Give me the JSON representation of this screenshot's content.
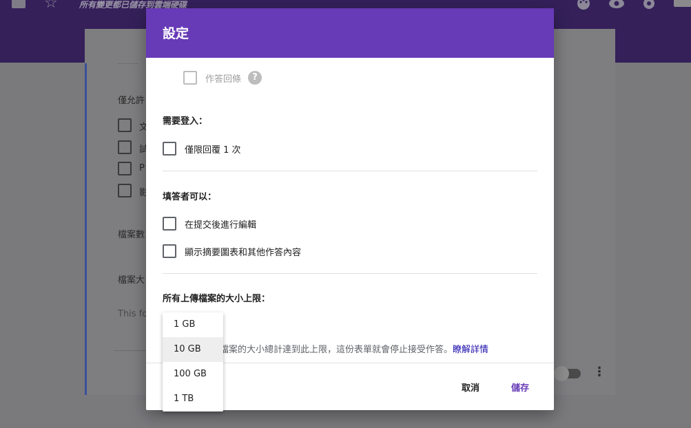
{
  "topbar": {
    "status_text": "所有變更都已儲存到雲端硬碟",
    "icons": [
      "document-icon",
      "star-icon",
      "palette-icon",
      "eye-icon",
      "gear-icon"
    ]
  },
  "background_form": {
    "label_allow": "僅允許",
    "options": [
      "文",
      "試",
      "P",
      "影"
    ],
    "label_file_count": "檔案數",
    "label_file_size": "檔案大",
    "note": "This fo"
  },
  "dialog": {
    "title": "設定",
    "response_receipt_label": "作答回條",
    "help_glyph": "?",
    "section_login": "需要登入：",
    "limit_one_response": "僅限回覆 1 次",
    "section_respondents": "填答者可以：",
    "edit_after_submit": "在提交後進行編輯",
    "see_summary": "顯示摘要圖表和其他作答內容",
    "section_upload_limit": "所有上傳檔案的大小上限：",
    "upload_note": "檔案的大小總計達到此上限，這份表單就會停止接受作答。",
    "learn_more": "瞭解詳情",
    "cancel_label": "取消",
    "save_label": "儲存"
  },
  "size_dropdown": {
    "options": [
      "1 GB",
      "10 GB",
      "100 GB",
      "1 TB"
    ],
    "selected": "10 GB"
  },
  "colors": {
    "header_purple": "#673ab7",
    "link_blue": "#1a0dab"
  }
}
